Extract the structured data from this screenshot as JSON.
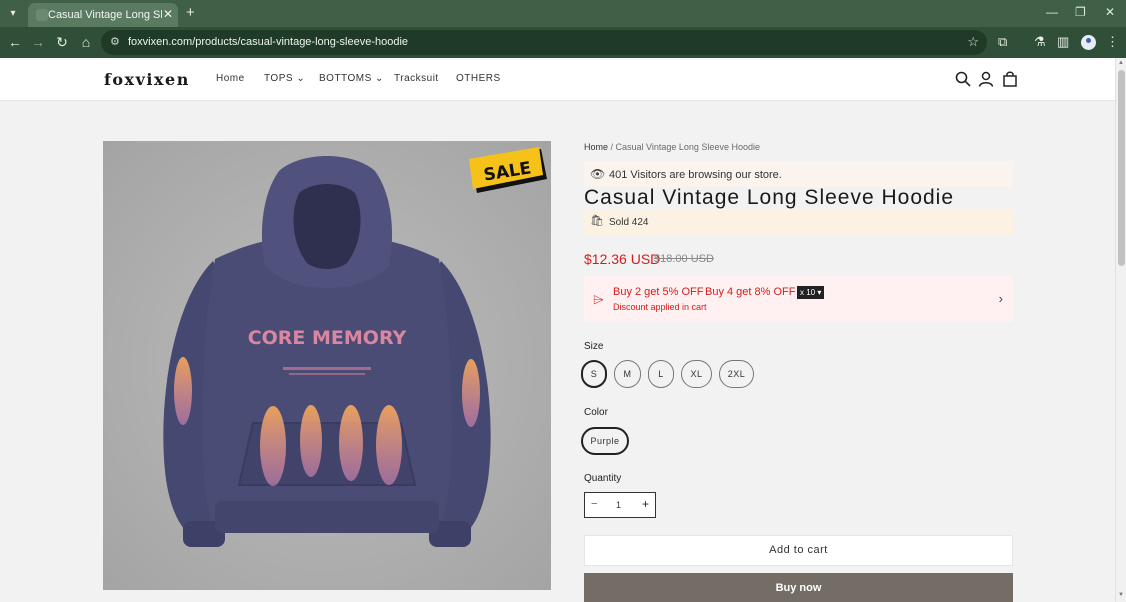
{
  "browser": {
    "tab_title": "Casual Vintage Long Sleeve Hoodie",
    "url": "foxvixen.com/products/casual-vintage-long-sleeve-hoodie"
  },
  "site": {
    "logo": "foxvixen",
    "nav": [
      {
        "label": "Home"
      },
      {
        "label": "TOPS",
        "has_dropdown": true
      },
      {
        "label": "BOTTOMS",
        "has_dropdown": true
      },
      {
        "label": "Tracksuit"
      },
      {
        "label": "OTHERS"
      }
    ],
    "header_icons": [
      "search-icon",
      "account-icon",
      "cart-icon"
    ]
  },
  "product": {
    "breadcrumb_home": "Home",
    "breadcrumb_sep": " / ",
    "breadcrumb_current": "Casual Vintage Long Sleeve Hoodie",
    "visitors_text": "401 Visitors are browsing our store.",
    "title": "Casual Vintage Long Sleeve Hoodie",
    "sold_text": "Sold 424",
    "price": "$12.36 USD",
    "compare_price": "$18.00 USD",
    "image_badge": "SALE",
    "image_print_text": "CORE MEMORY",
    "discount": {
      "offer1": "Buy 2 get 5% OFF",
      "offer2": "Buy 4 get 8% OFF",
      "note": "Discount applied in cart",
      "badge": "x 10 ▾"
    },
    "size_label": "Size",
    "sizes": [
      "S",
      "M",
      "L",
      "XL",
      "2XL"
    ],
    "selected_size": "S",
    "color_label": "Color",
    "colors": [
      "Purple"
    ],
    "selected_color": "Purple",
    "quantity_label": "Quantity",
    "quantity": "1",
    "add_to_cart": "Add to cart",
    "buy_now": "Buy now"
  },
  "colors": {
    "browser_tabbar": "#3f5f47",
    "browser_toolbar": "#2f4f38",
    "sale_red": "#d31d1d",
    "buy_now_bg": "#736d66"
  }
}
